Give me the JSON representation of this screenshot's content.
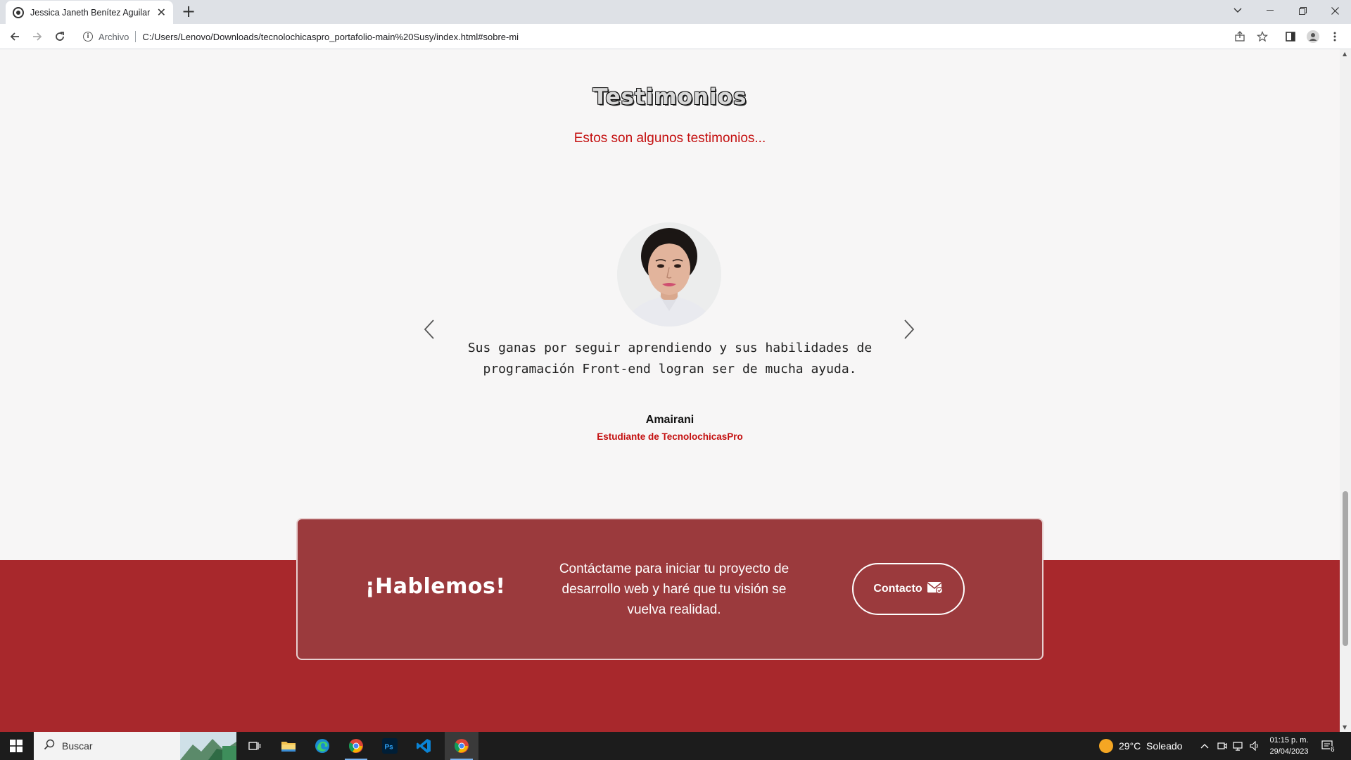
{
  "browser": {
    "tab_title": "Jessica Janeth Benítez Aguilar | D",
    "address_label": "Archivo",
    "url": "C:/Users/Lenovo/Downloads/tecnolochicaspro_portafolio-main%20Susy/index.html#sobre-mi"
  },
  "testimonials": {
    "title": "Testimonios",
    "subtitle": "Estos son algunos testimonios...",
    "quote": "Sus ganas por seguir aprendiendo y sus habilidades de programación Front-end logran ser de mucha ayuda.",
    "author": "Amairani",
    "role": "Estudiante de TecnolochicasPro"
  },
  "cta": {
    "title": "¡Hablemos!",
    "text": "Contáctame para iniciar tu proyecto de desarrollo web y haré que tu visión se vuelva realidad.",
    "button_label": "Contacto"
  },
  "taskbar": {
    "search_placeholder": "Buscar",
    "weather": "29°C  Soleado",
    "time": "01:15 p. m.",
    "date": "29/04/2023",
    "notification_count": "6"
  },
  "colors": {
    "accent_red": "#c41010",
    "footer_red": "#a8282c",
    "card_red": "#9b3a3d"
  }
}
